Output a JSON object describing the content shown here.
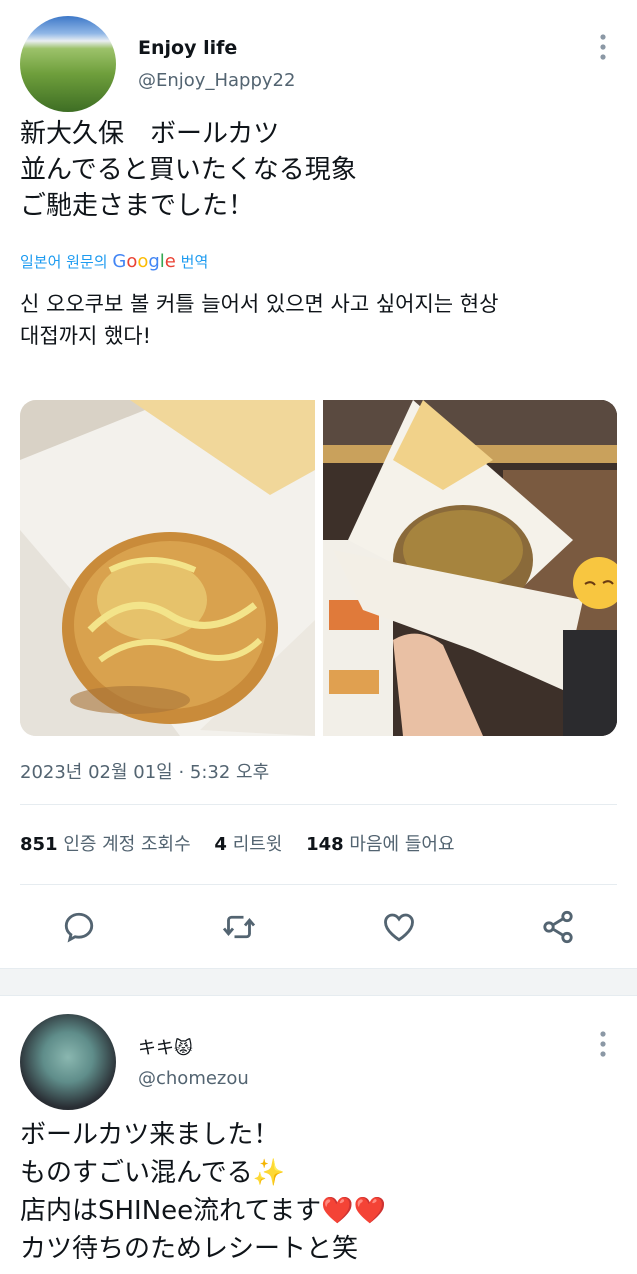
{
  "tweet": {
    "author_name": "Enjoy life",
    "author_handle": "@Enjoy_Happy22",
    "text_lines": [
      "新大久保　ボールカツ",
      "並んでると買いたくなる現象",
      "ご馳走さまでした！"
    ],
    "translate": {
      "prefix": "일본어 원문의",
      "google": [
        "G",
        "o",
        "o",
        "g",
        "l",
        "e"
      ],
      "suffix": "번역"
    },
    "translated_lines": [
      "신 오오쿠보 볼 커틀 늘어서 있으면 사고 싶어지는 현상",
      "대접까지 했다!"
    ],
    "timestamp": "2023년 02월 01일 · 5:32 오후",
    "stats": {
      "views_count": "851",
      "views_label": "인증 계정 조회수",
      "retweets_count": "4",
      "retweets_label": "리트윗",
      "likes_count": "148",
      "likes_label": "마음에 들어요"
    }
  },
  "reply": {
    "author_name": "キキ",
    "author_emoji": "😾",
    "author_handle": "@chomezou",
    "text_lines": [
      "ボールカツ来ました！",
      "ものすごい混んでる✨",
      "店内はSHINee流れてます❤️❤️",
      "カツ待ちのためレシートと笑"
    ]
  },
  "icons": [
    "more-vertical-icon",
    "reply-icon",
    "retweet-icon",
    "like-icon",
    "share-icon"
  ],
  "colors": {
    "link": "#1d9bf0",
    "secondary_text": "#536471",
    "divider": "#e6ecf0"
  }
}
